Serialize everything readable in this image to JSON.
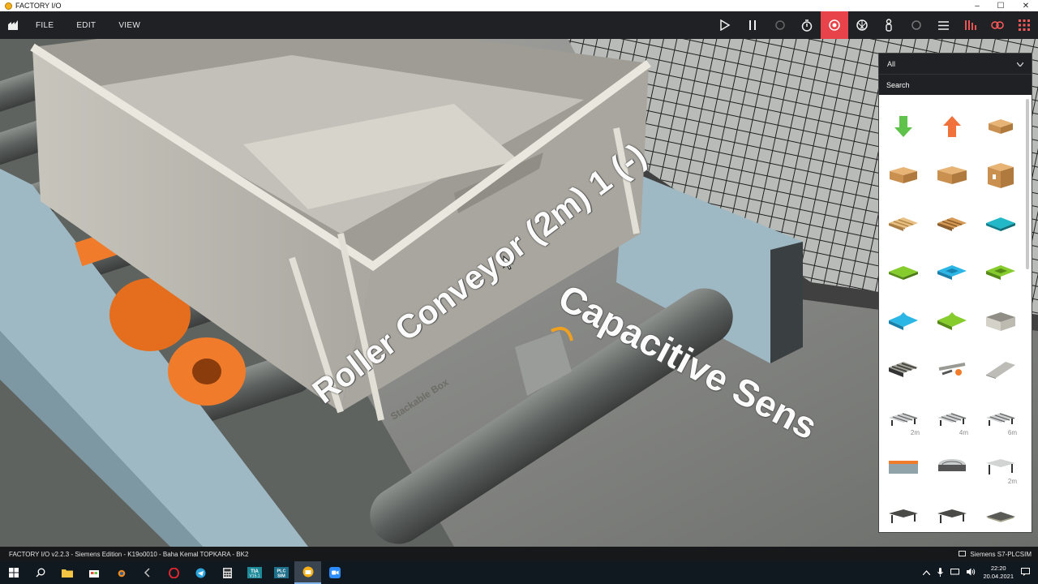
{
  "window": {
    "title": "FACTORY I/O",
    "minimize": "–",
    "maximize": "☐",
    "close": "✕"
  },
  "menu": {
    "file": "FILE",
    "edit": "EDIT",
    "view": "VIEW"
  },
  "toolbar": {
    "buttons": [
      {
        "name": "play",
        "glyph": "▶"
      },
      {
        "name": "pause",
        "glyph": "❚❚"
      },
      {
        "name": "reset",
        "glyph": "↻"
      },
      {
        "name": "timer",
        "glyph": "⏱"
      },
      {
        "name": "camera-orbit",
        "glyph": "◉"
      },
      {
        "name": "camera-fly",
        "glyph": "◎"
      },
      {
        "name": "camera-first-person",
        "glyph": "♙"
      },
      {
        "name": "select",
        "glyph": "○"
      },
      {
        "name": "list",
        "glyph": "☰"
      },
      {
        "name": "drivers",
        "glyph": "⫼"
      },
      {
        "name": "tags",
        "glyph": "⚙"
      },
      {
        "name": "palette",
        "glyph": "⋮⋮⋮"
      }
    ]
  },
  "palette": {
    "filter_value": "All",
    "search_placeholder": "Search",
    "size_labels": [
      "2m",
      "4m",
      "6m",
      "2m"
    ]
  },
  "scene": {
    "labels": [
      "Roller Conveyor (2m) 1 (-)",
      "Capacitive Sens"
    ],
    "box_print": "Stackable Box"
  },
  "statusbar": {
    "info": "FACTORY I/O v2.2.3 - Siemens Edition - K19o0010 - Baha Kemal TOPKARA - BK2",
    "driver": "Siemens S7-PLCSIM"
  },
  "taskbar": {
    "time": "22:20",
    "date": "20.04.2021"
  },
  "colors": {
    "accent": "#e8434a",
    "toolbar_bg": "#1f2124",
    "orange": "#f07c2b",
    "conveyor_blue": "#9fb9c4"
  }
}
